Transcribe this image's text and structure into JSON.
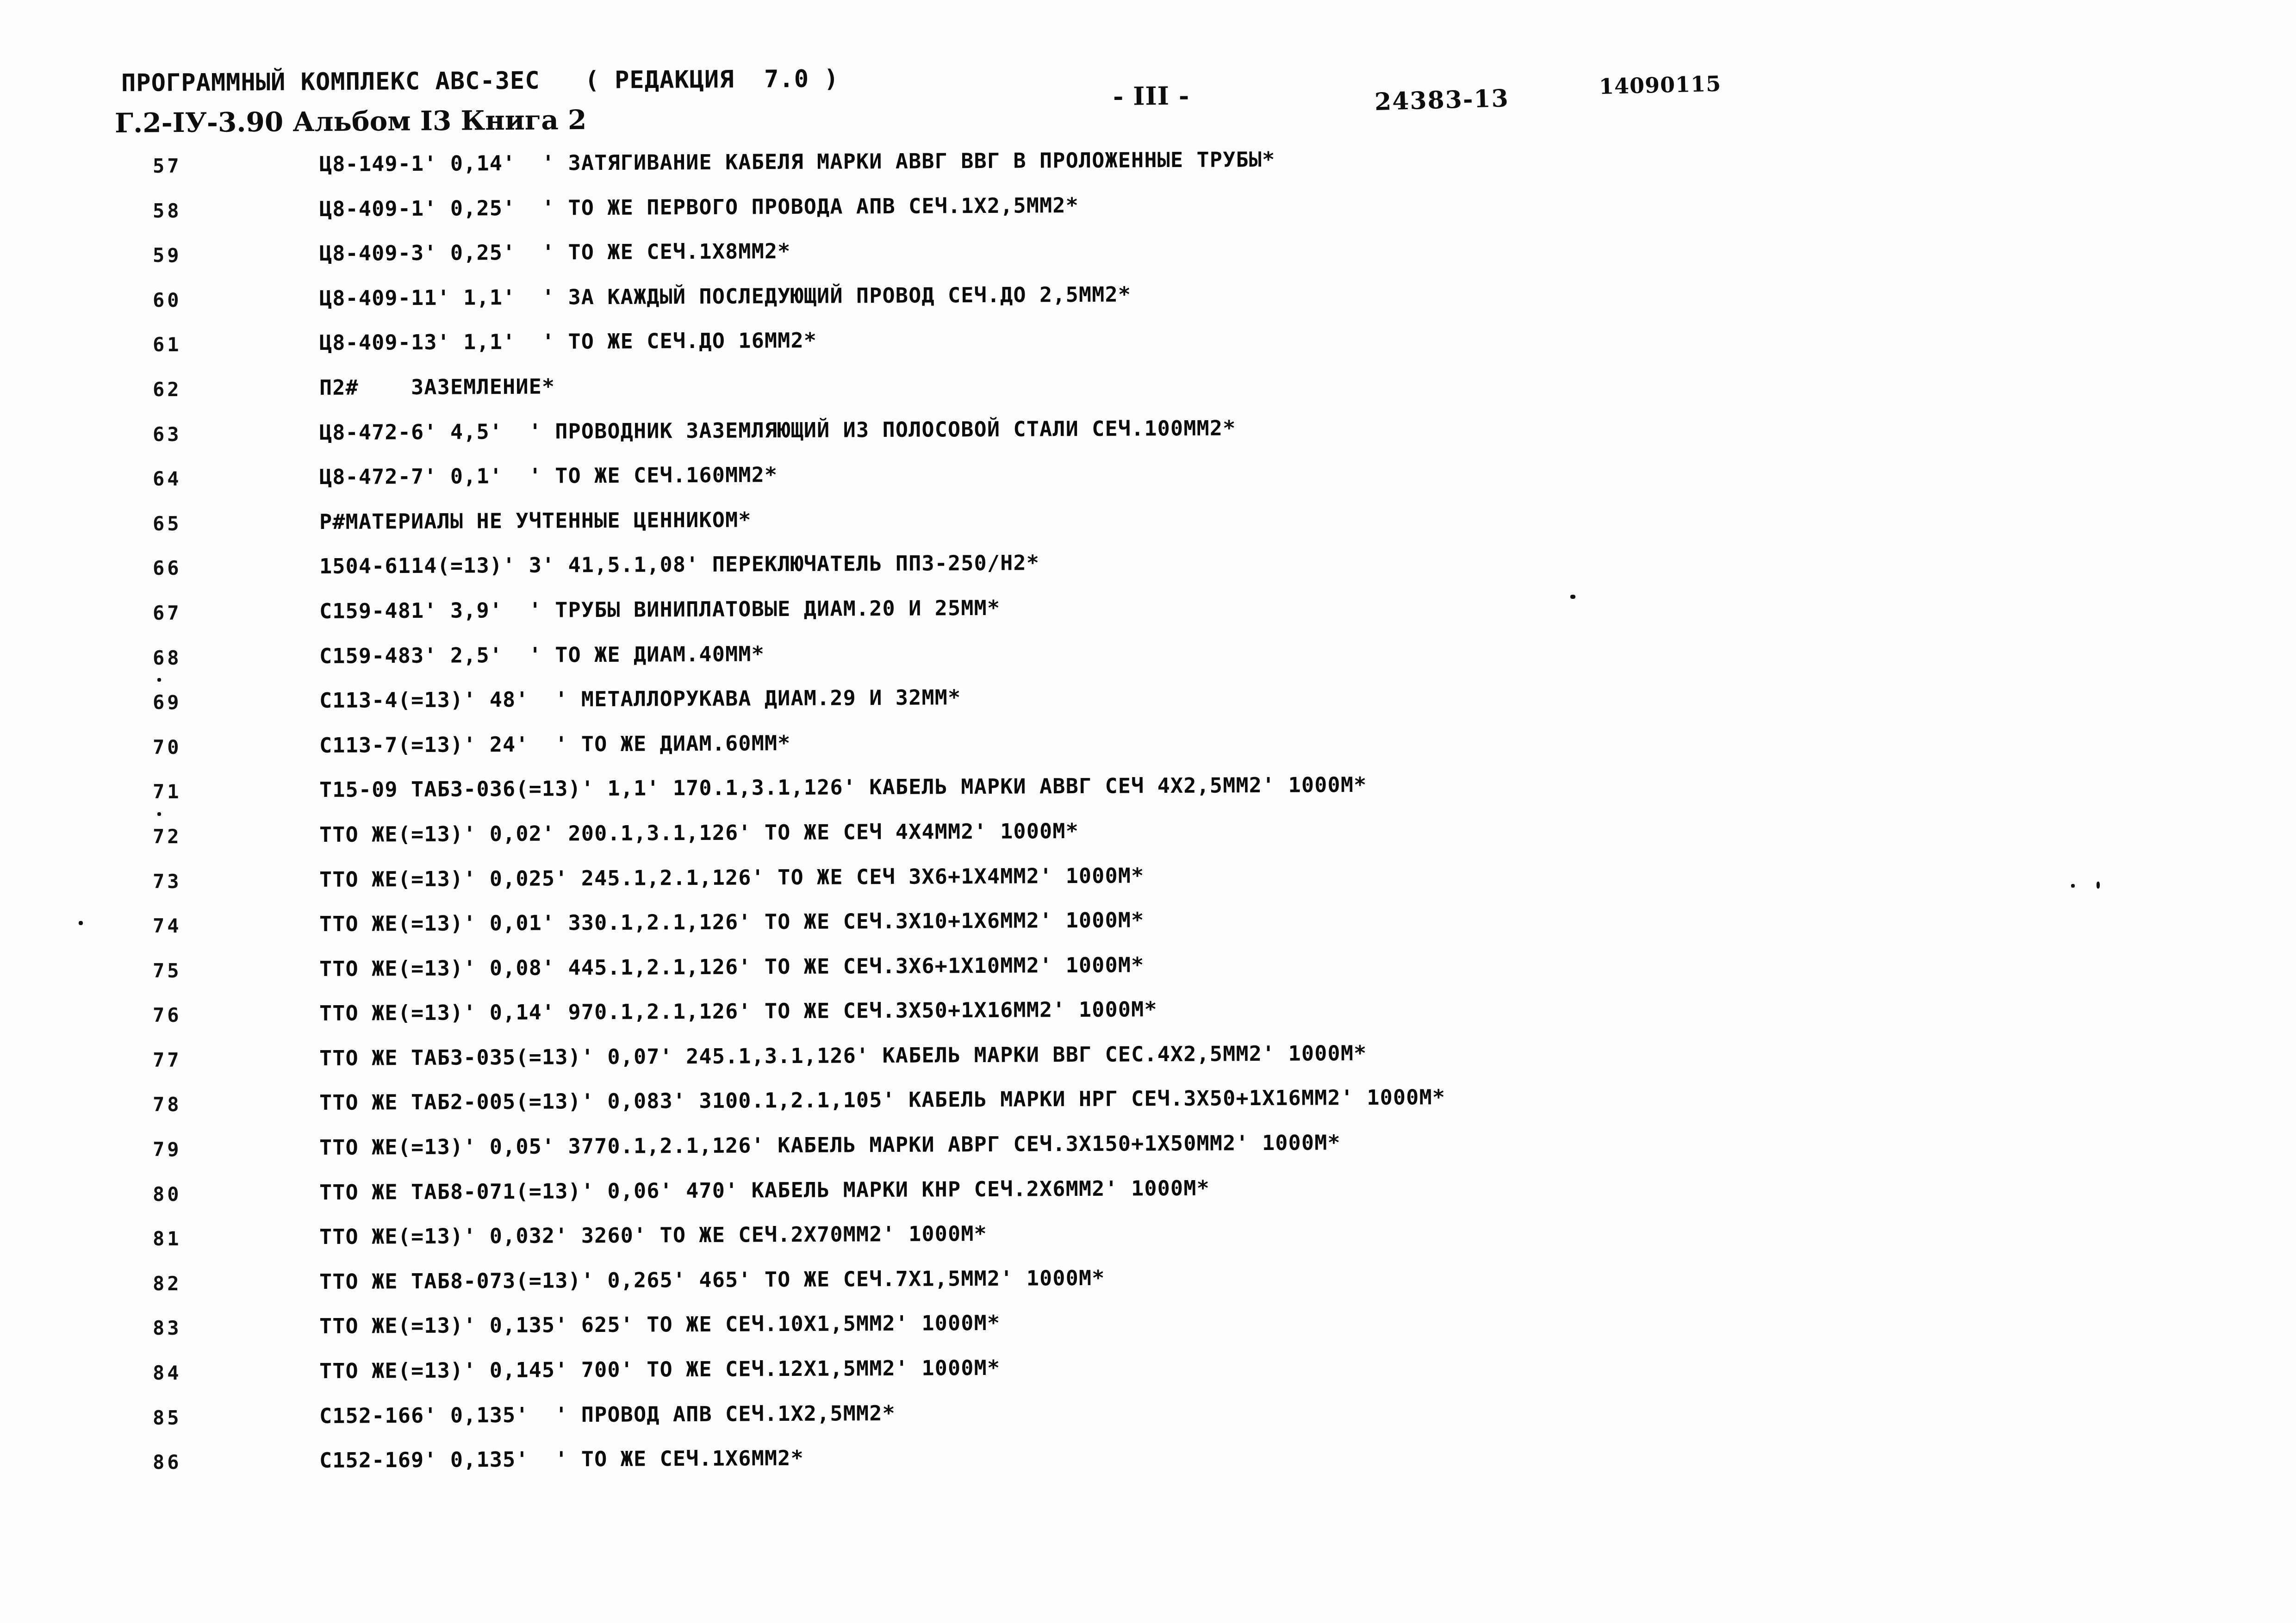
{
  "header": {
    "complex_title": "ПРОГРАММНЫЙ КОМПЛЕКС АВС-3ЕС   ( РЕДАКЦИЯ  7.0 )",
    "album_line": "Г.2-IУ-3.90 Альбом I3 Книга 2",
    "page_marker": "- III -",
    "doc_code": "24383-13",
    "serial_number": "14090115"
  },
  "listing": {
    "rows": [
      {
        "num": "57",
        "text": "Ц8-149-1' 0,14'  ' ЗАТЯГИВАНИЕ КАБЕЛЯ МАРКИ АВВГ ВВГ В ПРОЛОЖЕННЫЕ ТРУБЫ*"
      },
      {
        "num": "58",
        "text": "Ц8-409-1' 0,25'  ' ТО ЖЕ ПЕРВОГО ПРОВОДА АПВ СЕЧ.1Х2,5ММ2*"
      },
      {
        "num": "59",
        "text": "Ц8-409-3' 0,25'  ' ТО ЖЕ СЕЧ.1Х8ММ2*"
      },
      {
        "num": "60",
        "text": "Ц8-409-11' 1,1'  ' ЗА КАЖДЫЙ ПОСЛЕДУЮЩИЙ ПРОВОД СЕЧ.ДО 2,5ММ2*"
      },
      {
        "num": "61",
        "text": "Ц8-409-13' 1,1'  ' ТО ЖЕ СЕЧ.ДО 16ММ2*"
      },
      {
        "num": "62",
        "text": "П2#    ЗАЗЕМЛЕНИЕ*"
      },
      {
        "num": "63",
        "text": "Ц8-472-6' 4,5'  ' ПРОВОДНИК ЗАЗЕМЛЯЮЩИЙ ИЗ ПОЛОСОВОЙ СТАЛИ СЕЧ.100ММ2*"
      },
      {
        "num": "64",
        "text": "Ц8-472-7' 0,1'  ' ТО ЖЕ СЕЧ.160ММ2*"
      },
      {
        "num": "65",
        "text": "Р#МАТЕРИАЛЫ НЕ УЧТЕННЫЕ ЦЕННИКОМ*"
      },
      {
        "num": "66",
        "text": "1504-6114(=13)' 3' 41,5.1,08' ПЕРЕКЛЮЧАТЕЛЬ ПП3-250/Н2*"
      },
      {
        "num": "67",
        "text": "С159-481' 3,9'  ' ТРУБЫ ВИНИПЛАТОВЫЕ ДИАМ.20 И 25ММ*"
      },
      {
        "num": "68",
        "text": "С159-483' 2,5'  ' ТО ЖЕ ДИАМ.40ММ*"
      },
      {
        "num": "69",
        "text": "С113-4(=13)' 48'  ' МЕТАЛЛОРУКАВА ДИАМ.29 И 32ММ*"
      },
      {
        "num": "70",
        "text": "С113-7(=13)' 24'  ' ТО ЖЕ ДИАМ.60ММ*"
      },
      {
        "num": "71",
        "text": "Т15-09 ТАБ3-036(=13)' 1,1' 170.1,3.1,126' КАБЕЛЬ МАРКИ АВВГ СЕЧ 4Х2,5ММ2' 1000М*"
      },
      {
        "num": "72",
        "text": "ТТО ЖЕ(=13)' 0,02' 200.1,3.1,126' ТО ЖЕ СЕЧ 4Х4ММ2' 1000М*"
      },
      {
        "num": "73",
        "text": "ТТО ЖЕ(=13)' 0,025' 245.1,2.1,126' ТО ЖЕ СЕЧ 3Х6+1Х4ММ2' 1000М*"
      },
      {
        "num": "74",
        "text": "ТТО ЖЕ(=13)' 0,01' 330.1,2.1,126' ТО ЖЕ СЕЧ.3Х10+1Х6ММ2' 1000М*"
      },
      {
        "num": "75",
        "text": "ТТО ЖЕ(=13)' 0,08' 445.1,2.1,126' ТО ЖЕ СЕЧ.3Х6+1Х10ММ2' 1000М*"
      },
      {
        "num": "76",
        "text": "ТТО ЖЕ(=13)' 0,14' 970.1,2.1,126' ТО ЖЕ СЕЧ.3Х50+1Х16ММ2' 1000М*"
      },
      {
        "num": "77",
        "text": "ТТО ЖЕ ТАБ3-035(=13)' 0,07' 245.1,3.1,126' КАБЕЛЬ МАРКИ ВВГ СЕС.4Х2,5ММ2' 1000М*"
      },
      {
        "num": "78",
        "text": "ТТО ЖЕ ТАБ2-005(=13)' 0,083' 3100.1,2.1,105' КАБЕЛЬ МАРКИ НРГ СЕЧ.3Х50+1Х16ММ2' 1000М*"
      },
      {
        "num": "79",
        "text": "ТТО ЖЕ(=13)' 0,05' 3770.1,2.1,126' КАБЕЛЬ МАРКИ АВРГ СЕЧ.3Х150+1Х50ММ2' 1000М*"
      },
      {
        "num": "80",
        "text": "ТТО ЖЕ ТАБ8-071(=13)' 0,06' 470' КАБЕЛЬ МАРКИ КНР СЕЧ.2Х6ММ2' 1000М*"
      },
      {
        "num": "81",
        "text": "ТТО ЖЕ(=13)' 0,032' 3260' ТО ЖЕ СЕЧ.2Х70ММ2' 1000М*"
      },
      {
        "num": "82",
        "text": "ТТО ЖЕ ТАБ8-073(=13)' 0,265' 465' ТО ЖЕ СЕЧ.7Х1,5ММ2' 1000М*"
      },
      {
        "num": "83",
        "text": "ТТО ЖЕ(=13)' 0,135' 625' ТО ЖЕ СЕЧ.10Х1,5ММ2' 1000М*"
      },
      {
        "num": "84",
        "text": "ТТО ЖЕ(=13)' 0,145' 700' ТО ЖЕ СЕЧ.12Х1,5ММ2' 1000М*"
      },
      {
        "num": "85",
        "text": "С152-166' 0,135'  ' ПРОВОД АПВ СЕЧ.1Х2,5ММ2*"
      },
      {
        "num": "86",
        "text": "С152-169' 0,135'  ' ТО ЖЕ СЕЧ.1Х6ММ2*"
      }
    ]
  }
}
